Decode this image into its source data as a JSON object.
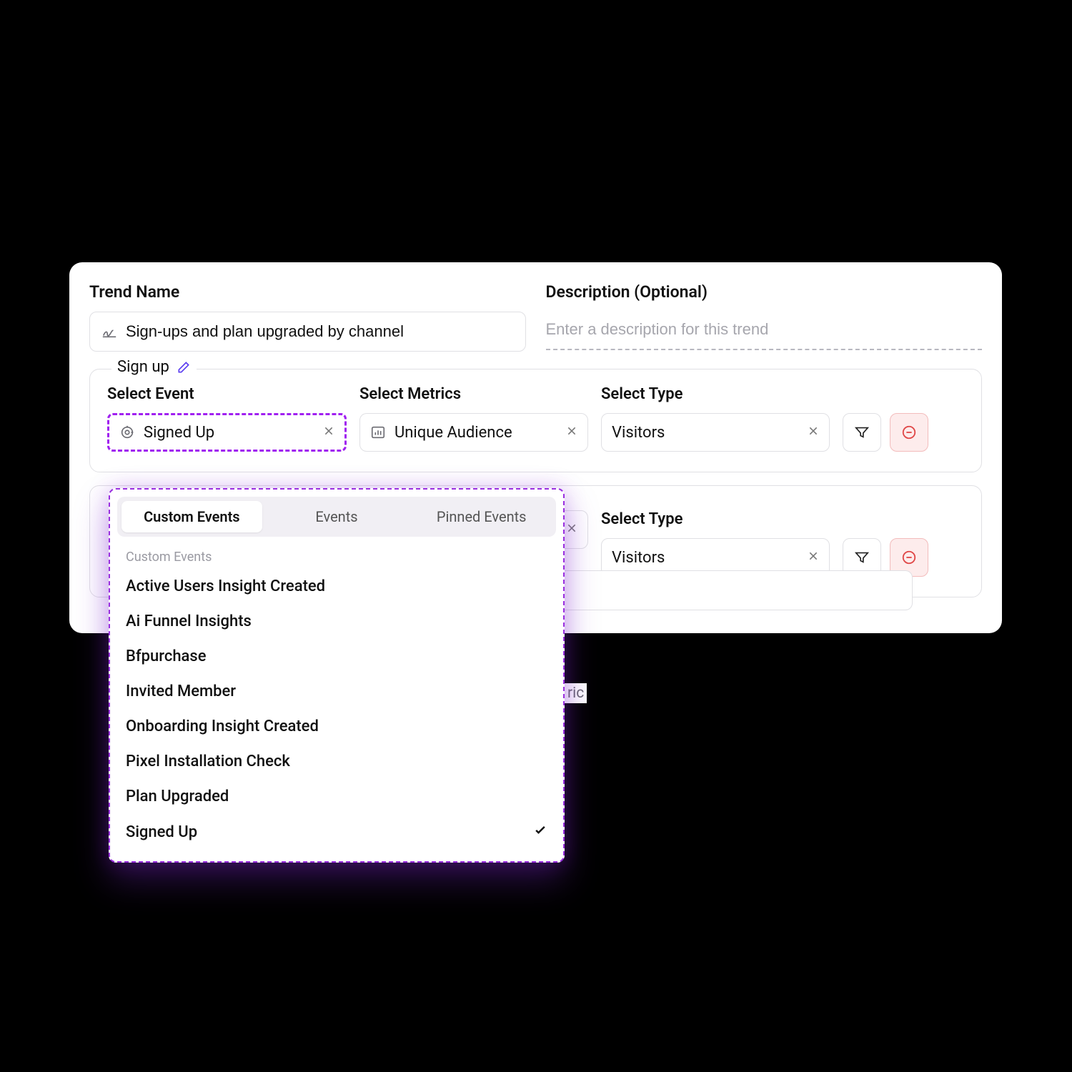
{
  "header": {
    "trend_label": "Trend Name",
    "desc_label": "Description (Optional)",
    "trend_value": "Sign-ups and plan upgraded by channel",
    "desc_placeholder": "Enter a description for this trend"
  },
  "sections": [
    {
      "legend": "Sign up",
      "event_label": "Select Event",
      "metrics_label": "Select Metrics",
      "type_label": "Select Type",
      "event_value": "Signed Up",
      "metrics_value": "Unique Audience",
      "type_value": "Visitors",
      "event_focused": true
    },
    {
      "legend": "",
      "event_label": "",
      "metrics_label": "",
      "type_label": "Select Type",
      "event_value": "",
      "metrics_value": "",
      "type_value": "Visitors"
    }
  ],
  "add_metric_hint": "ric",
  "dropdown": {
    "tabs": [
      "Custom Events",
      "Events",
      "Pinned Events"
    ],
    "active_tab": "Custom Events",
    "group_label": "Custom Events",
    "options": [
      {
        "label": "Active Users Insight Created",
        "selected": false
      },
      {
        "label": "Ai Funnel Insights",
        "selected": false
      },
      {
        "label": "Bfpurchase",
        "selected": false
      },
      {
        "label": "Invited Member",
        "selected": false
      },
      {
        "label": "Onboarding Insight Created",
        "selected": false
      },
      {
        "label": "Pixel Installation Check",
        "selected": false
      },
      {
        "label": "Plan Upgraded",
        "selected": false
      },
      {
        "label": "Signed Up",
        "selected": true
      }
    ]
  }
}
